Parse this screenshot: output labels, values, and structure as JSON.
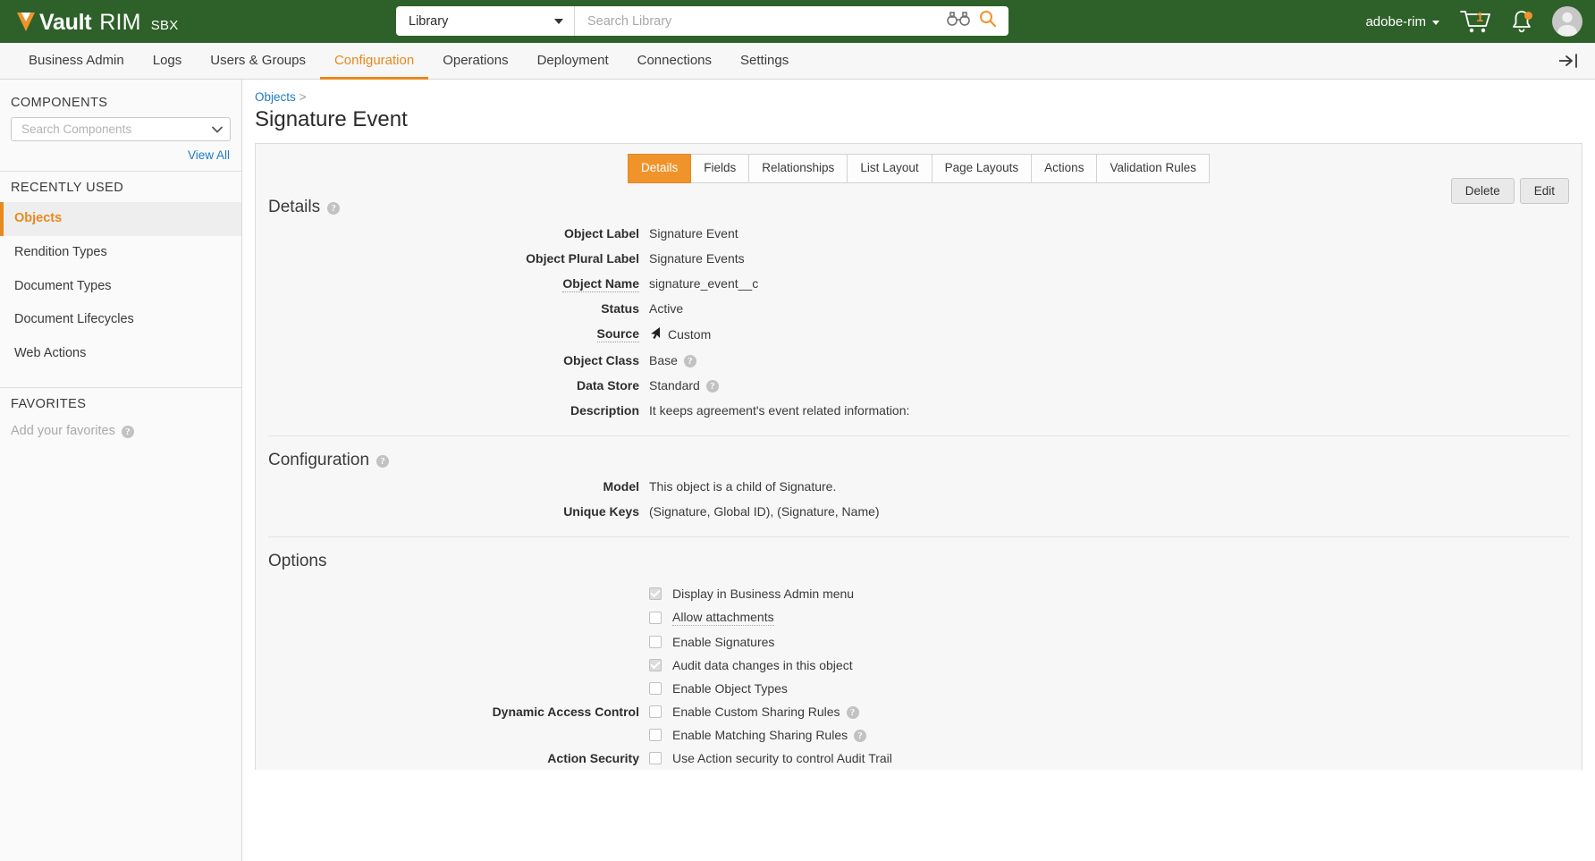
{
  "header": {
    "brand_vault": "Vault",
    "brand_rim": "RIM",
    "brand_env": "SBX",
    "search_scope": "Library",
    "search_placeholder": "Search Library",
    "user": "adobe-rim",
    "cart_count": "1"
  },
  "nav": {
    "items": [
      {
        "label": "Business Admin",
        "active": false
      },
      {
        "label": "Logs",
        "active": false
      },
      {
        "label": "Users & Groups",
        "active": false
      },
      {
        "label": "Configuration",
        "active": true
      },
      {
        "label": "Operations",
        "active": false
      },
      {
        "label": "Deployment",
        "active": false
      },
      {
        "label": "Connections",
        "active": false
      },
      {
        "label": "Settings",
        "active": false
      }
    ]
  },
  "sidebar": {
    "components_title": "COMPONENTS",
    "components_search_placeholder": "Search Components",
    "view_all": "View All",
    "recently_used_title": "RECENTLY USED",
    "recent_items": [
      {
        "label": "Objects",
        "active": true
      },
      {
        "label": "Rendition Types",
        "active": false
      },
      {
        "label": "Document Types",
        "active": false
      },
      {
        "label": "Document Lifecycles",
        "active": false
      },
      {
        "label": "Web Actions",
        "active": false
      }
    ],
    "favorites_title": "FAVORITES",
    "favorites_empty": "Add your favorites"
  },
  "main": {
    "breadcrumb_parent": "Objects",
    "breadcrumb_sep": ">",
    "page_title": "Signature Event",
    "tabs": [
      {
        "label": "Details",
        "active": true
      },
      {
        "label": "Fields",
        "active": false
      },
      {
        "label": "Relationships",
        "active": false
      },
      {
        "label": "List Layout",
        "active": false
      },
      {
        "label": "Page Layouts",
        "active": false
      },
      {
        "label": "Actions",
        "active": false
      },
      {
        "label": "Validation Rules",
        "active": false
      }
    ],
    "buttons": {
      "delete": "Delete",
      "edit": "Edit"
    },
    "details": {
      "heading": "Details",
      "rows": [
        {
          "label": "Object Label",
          "value": "Signature Event",
          "dotted": false,
          "help": false,
          "icon": ""
        },
        {
          "label": "Object Plural Label",
          "value": "Signature Events",
          "dotted": false,
          "help": false,
          "icon": ""
        },
        {
          "label": "Object Name",
          "value": "signature_event__c",
          "dotted": true,
          "help": false,
          "icon": ""
        },
        {
          "label": "Status",
          "value": "Active",
          "dotted": false,
          "help": false,
          "icon": ""
        },
        {
          "label": "Source",
          "value": "Custom",
          "dotted": true,
          "help": false,
          "icon": "cursor-arrow-icon"
        },
        {
          "label": "Object Class",
          "value": "Base",
          "dotted": false,
          "help": true,
          "icon": ""
        },
        {
          "label": "Data Store",
          "value": "Standard",
          "dotted": false,
          "help": true,
          "icon": ""
        },
        {
          "label": "Description",
          "value": "It keeps agreement's event related information:",
          "dotted": false,
          "help": false,
          "icon": ""
        }
      ]
    },
    "configuration": {
      "heading": "Configuration",
      "rows": [
        {
          "label": "Model",
          "value": "This object is a child of Signature."
        },
        {
          "label": "Unique Keys",
          "value": "(Signature, Global ID), (Signature, Name)"
        }
      ]
    },
    "options": {
      "heading": "Options",
      "rows": [
        {
          "group_label": "",
          "label": "Display in Business Admin menu",
          "checked": true,
          "dotted": false,
          "help": false
        },
        {
          "group_label": "",
          "label": "Allow attachments",
          "checked": false,
          "dotted": true,
          "help": false
        },
        {
          "group_label": "",
          "label": "Enable Signatures",
          "checked": false,
          "dotted": false,
          "help": false
        },
        {
          "group_label": "",
          "label": "Audit data changes in this object",
          "checked": true,
          "dotted": false,
          "help": false
        },
        {
          "group_label": "",
          "label": "Enable Object Types",
          "checked": false,
          "dotted": false,
          "help": false
        },
        {
          "group_label": "Dynamic Access Control",
          "label": "Enable Custom Sharing Rules",
          "checked": false,
          "dotted": false,
          "help": true
        },
        {
          "group_label": "",
          "label": "Enable Matching Sharing Rules",
          "checked": false,
          "dotted": false,
          "help": true
        },
        {
          "group_label": "Action Security",
          "label": "Use Action security to control Audit Trail",
          "checked": false,
          "dotted": false,
          "help": false
        }
      ]
    }
  },
  "colors": {
    "brand_green": "#2e6129",
    "accent_orange": "#e8891c",
    "tab_orange": "#f0932b",
    "link_blue": "#1e7bc4"
  }
}
